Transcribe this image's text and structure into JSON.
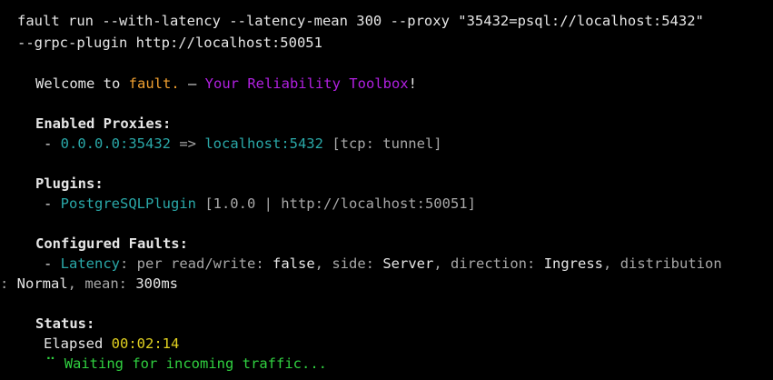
{
  "command": {
    "line1": "fault run --with-latency --latency-mean 300 --proxy \"35432=psql://localhost:5432\"",
    "line2": "--grpc-plugin http://localhost:50051"
  },
  "welcome": {
    "prefix": "Welcome to ",
    "app_name": "fault.",
    "dash": " — ",
    "tagline": "Your Reliability Toolbox",
    "suffix": "!"
  },
  "proxies": {
    "heading": "Enabled Proxies:",
    "items": [
      {
        "bullet": "- ",
        "source": "0.0.0.0:35432",
        "arrow": " => ",
        "target": "localhost:5432",
        "mode": " [tcp: tunnel]"
      }
    ]
  },
  "plugins": {
    "heading": "Plugins:",
    "items": [
      {
        "bullet": "- ",
        "name": "PostgreSQLPlugin",
        "details": " [1.0.0 | http://localhost:50051]"
      }
    ]
  },
  "faults": {
    "heading": "Configured Faults:",
    "items": [
      {
        "bullet": "- ",
        "name": "Latency",
        "k1": "per read/write",
        "v1": "false",
        "k2": "side",
        "v2": "Server",
        "k3": "direction",
        "v3": "Ingress",
        "k4": "distribution",
        "v4": "Normal",
        "k5": "mean",
        "v5": "300ms"
      }
    ]
  },
  "status": {
    "heading": "Status:",
    "elapsed_label": "Elapsed ",
    "elapsed_value": "00:02:14",
    "spinner": "⠉",
    "waiting": " Waiting for incoming traffic..."
  },
  "colors": {
    "background": "#000000",
    "text": "#e6e6e6",
    "muted": "#a8a8a8",
    "app_name": "#f0a030",
    "tagline": "#b020e0",
    "accent": "#2aa8a8",
    "elapsed": "#e0d020",
    "waiting": "#30d040"
  }
}
